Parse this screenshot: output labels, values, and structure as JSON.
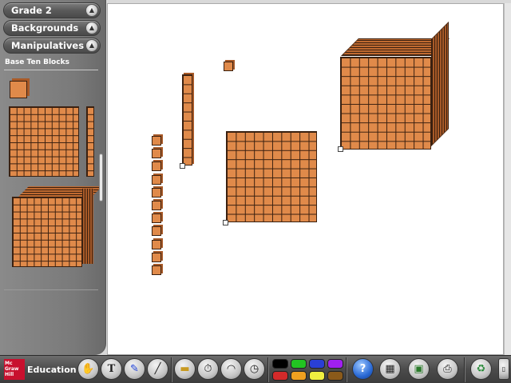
{
  "sidebar": {
    "menus": [
      {
        "label": "Grade 2",
        "icon": "caret-up-icon"
      },
      {
        "label": "Backgrounds",
        "icon": "caret-up-icon"
      },
      {
        "label": "Manipulatives",
        "icon": "caret-up-icon"
      }
    ],
    "section_label": "Base Ten Blocks",
    "palette": [
      "unit-cube",
      "flat",
      "rod",
      "thousand-cube"
    ]
  },
  "colors": {
    "block_face": "#e08a4a",
    "block_side": "#a85a28",
    "block_line": "#3a2010",
    "brand_red": "#c8102e"
  },
  "canvas_blocks": [
    {
      "type": "rod",
      "count": 1
    },
    {
      "type": "unit",
      "count": 12
    },
    {
      "type": "flat",
      "count": 1
    },
    {
      "type": "thousand-cube",
      "count": 1
    }
  ],
  "toolbar": {
    "brand_logo_text": "Mc Graw Hill",
    "brand_text": "Education",
    "tools": [
      "hand-icon",
      "text-icon",
      "pen-icon",
      "line-icon",
      "ruler-icon",
      "timer-icon",
      "protractor-icon",
      "clock-icon"
    ],
    "colors": [
      "#000000",
      "#22c322",
      "#2a3fd6",
      "#a020f0",
      "#d42a2a",
      "#f0a020",
      "#f0f040",
      "#8a5a1a"
    ],
    "actions": [
      "help-icon",
      "calendar-icon",
      "gallery-icon",
      "print-icon",
      "trash-icon"
    ]
  }
}
